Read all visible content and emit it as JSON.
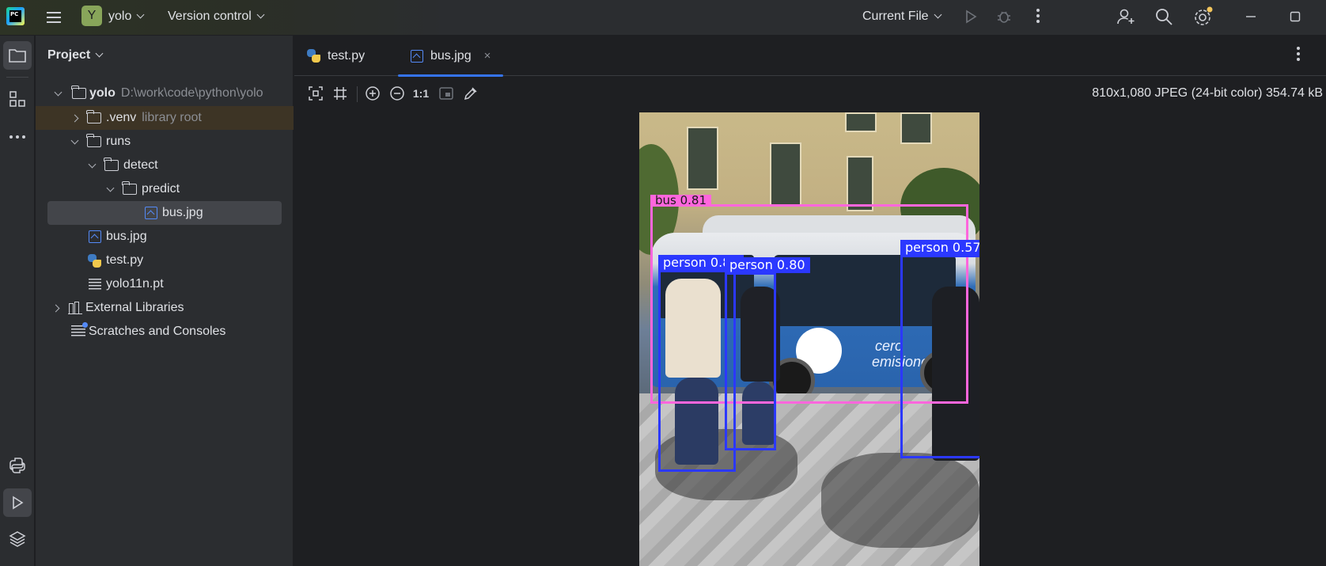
{
  "titlebar": {
    "project_badge": "Y",
    "project_name": "yolo",
    "version_control": "Version control",
    "run_config": "Current File",
    "logo_text": "PC"
  },
  "project_panel": {
    "header": "Project",
    "tree": [
      {
        "label": "yolo",
        "hint": "D:\\work\\code\\python\\yolo"
      },
      {
        "label": ".venv",
        "hint": "library root"
      },
      {
        "label": "runs"
      },
      {
        "label": "detect"
      },
      {
        "label": "predict"
      },
      {
        "label": "bus.jpg"
      },
      {
        "label": "bus.jpg"
      },
      {
        "label": "test.py"
      },
      {
        "label": "yolo11n.pt"
      },
      {
        "label": "External Libraries"
      },
      {
        "label": "Scratches and Consoles"
      }
    ]
  },
  "editor": {
    "tabs": [
      {
        "label": "test.py"
      },
      {
        "label": "bus.jpg",
        "close": "×"
      }
    ],
    "image_toolbar": {
      "actual_size_label": "1:1"
    },
    "image_info": "810x1,080 JPEG (24-bit color) 354.74 kB",
    "detections": [
      {
        "label": "bus  0.81",
        "class": "bus",
        "confidence": 0.81
      },
      {
        "label": "person  0.82",
        "class": "person",
        "confidence": 0.82
      },
      {
        "label": "person  0.80",
        "class": "person",
        "confidence": 0.8
      },
      {
        "label": "person  0.57",
        "class": "person",
        "confidence": 0.57
      }
    ],
    "bus_text": [
      "cero",
      "emisiones"
    ]
  },
  "colors": {
    "accent": "#3574f0",
    "bus_box": "#ff66dd",
    "person_box": "#2b38ff",
    "venv_highlight": "#3d3425"
  }
}
